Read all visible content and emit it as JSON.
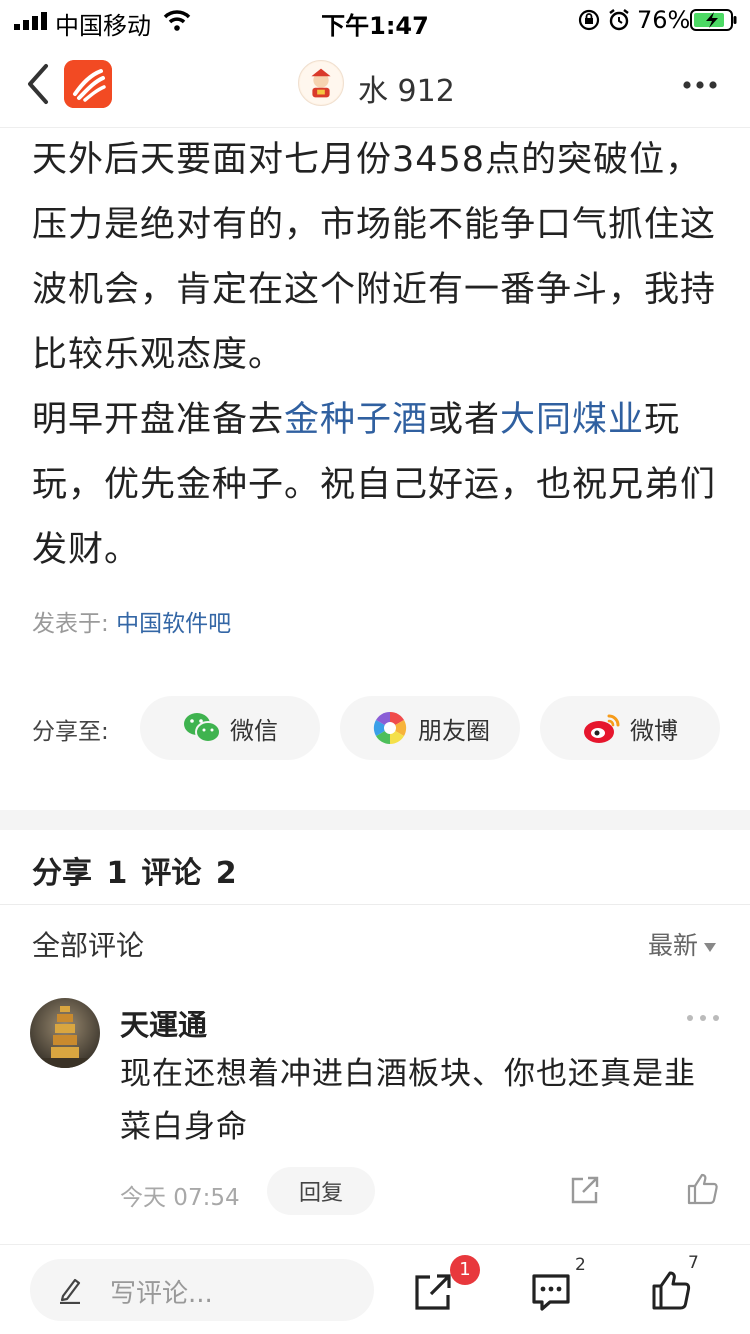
{
  "status_bar": {
    "carrier": "中国移动",
    "time": "下午1:47",
    "battery_pct": "76%"
  },
  "nav": {
    "username": "水 912",
    "icons": [
      "back-icon",
      "app-logo",
      "avatar",
      "more-icon"
    ]
  },
  "article": {
    "p1": "天外后天要面对七月份3458点的突破位，压力是绝对有的，市场能不能争口气抓住这波机会，肯定在这个附近有一番争斗，我持比较乐观态度。",
    "p2_a": "明早开盘准备去",
    "p2_link1": "金种子酒",
    "p2_b": "或者",
    "p2_link2": "大同煤业",
    "p2_c": "玩玩，优先金种子。祝自己好运，也祝兄弟们发财。"
  },
  "source": {
    "label": "发表于:",
    "forum": "中国软件吧"
  },
  "share": {
    "label": "分享至:",
    "wechat": "微信",
    "moments": "朋友圈",
    "weibo": "微博"
  },
  "counts": {
    "share": "分享 1",
    "comment": "评论 2"
  },
  "comments_header": {
    "title": "全部评论",
    "sort": "最新"
  },
  "comment": {
    "name": "天運通",
    "text": "现在还想着冲进白酒板块、你也还真是韭菜白身命",
    "time": "今天 07:54",
    "reply": "回复"
  },
  "bottom_bar": {
    "placeholder": "写评论...",
    "share_badge": "1",
    "comment_count": "2",
    "like_count": "7"
  },
  "colors": {
    "link": "#3060a0",
    "badge": "#e8383d",
    "logo": "#f24a23"
  }
}
